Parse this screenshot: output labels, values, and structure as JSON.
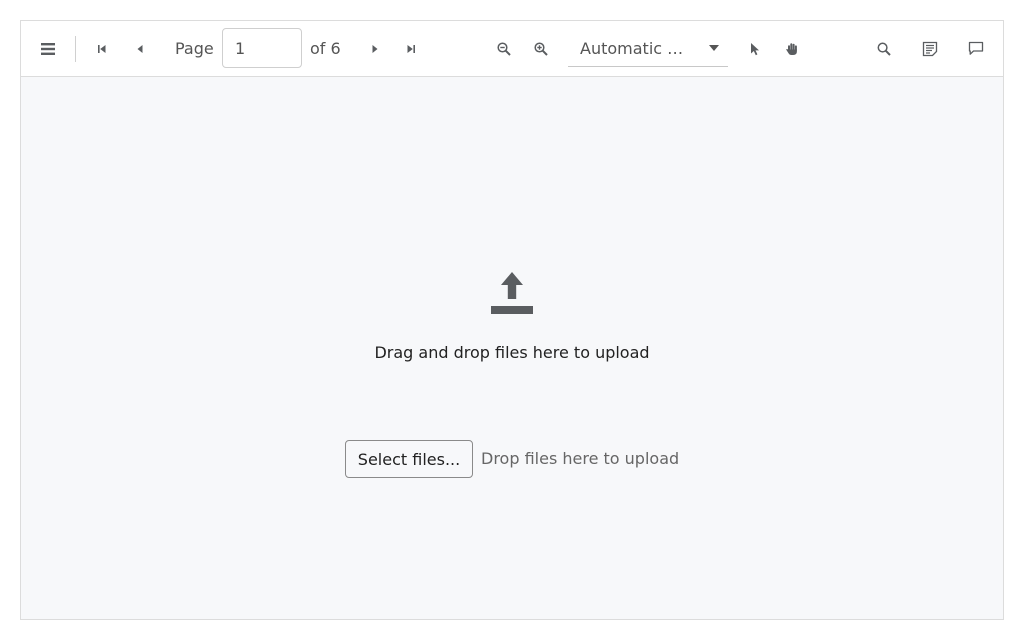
{
  "toolbar": {
    "page_label": "Page",
    "page_value": "1",
    "page_total": "of 6",
    "zoom_value": "Automatic Zoom",
    "zoom_display": "Automatic  …",
    "icons": {
      "sidebar": "sidebar-toggle-icon",
      "first_page": "first-page-icon",
      "prev_page": "previous-page-icon",
      "next_page": "next-page-icon",
      "last_page": "last-page-icon",
      "zoom_out": "zoom-out-icon",
      "zoom_in": "zoom-in-icon",
      "select_tool": "select-cursor-icon",
      "hand_tool": "hand-tool-icon",
      "search": "search-icon",
      "annotations": "annotations-icon",
      "comment": "comment-icon"
    }
  },
  "dropzone": {
    "title": "Drag and drop files here to upload",
    "select_button": "Select files...",
    "hint": "Drop files here to upload",
    "icon": "upload-icon"
  },
  "colors": {
    "toolbar_bg": "#ffffff",
    "content_bg": "#f7f8fa",
    "icon": "#5a5d60",
    "border": "#dcdcdc"
  }
}
